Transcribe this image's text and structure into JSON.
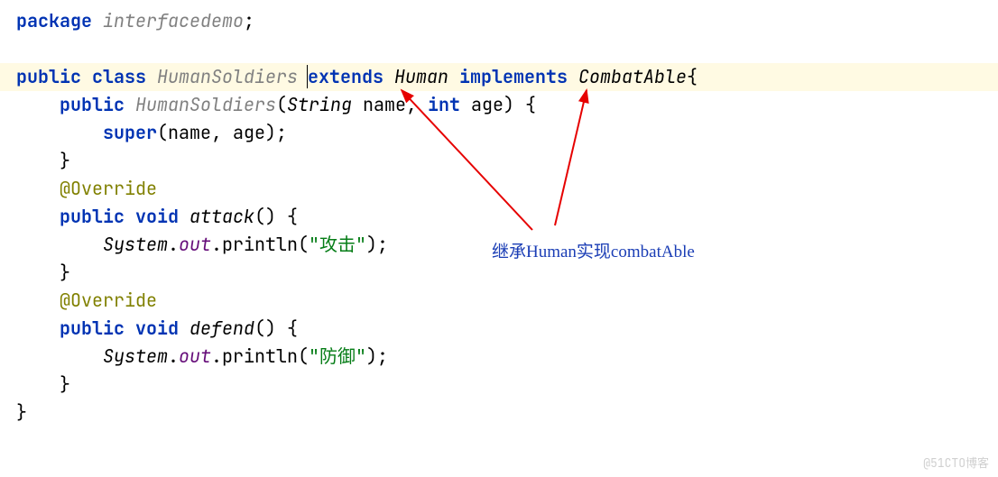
{
  "code": {
    "line1": {
      "package": "package",
      "pkg_name": " interfacedemo",
      "semi": ";"
    },
    "line3": {
      "public": "public",
      "class": "class",
      "cls_name": "HumanSoldiers",
      "extends": "extends",
      "parent": "Human",
      "implements": "implements",
      "iface": "CombatAble",
      "brace": "{"
    },
    "line4": {
      "public": "public",
      "ctor": "HumanSoldiers",
      "lparen": "(",
      "str_type": "String",
      "name_param": " name",
      "comma": ", ",
      "int_type": "int",
      "age_param": " age",
      "rparen_brace": ") {"
    },
    "line5": {
      "super": "super",
      "args": "(name, age);"
    },
    "line6": {
      "brace": "}"
    },
    "line7": {
      "ann": "@Override"
    },
    "line8": {
      "public": "public",
      "void": "void",
      "method": "attack",
      "tail": "() {"
    },
    "line9": {
      "sys": "System",
      "dot1": ".",
      "out": "out",
      "dot2": ".",
      "println": "println",
      "lparen": "(",
      "str": "\"攻击\"",
      "rparen": ");"
    },
    "line10": {
      "brace": "}"
    },
    "line11": {
      "ann": "@Override"
    },
    "line12": {
      "public": "public",
      "void": "void",
      "method": "defend",
      "tail": "() {"
    },
    "line13": {
      "sys": "System",
      "dot1": ".",
      "out": "out",
      "dot2": ".",
      "println": "println",
      "lparen": "(",
      "str": "\"防御\"",
      "rparen": ");"
    },
    "line14": {
      "brace": "}"
    },
    "line15": {
      "brace": "}"
    }
  },
  "annotation": "继承Human实现combatAble",
  "watermark": "@51CTO博客"
}
